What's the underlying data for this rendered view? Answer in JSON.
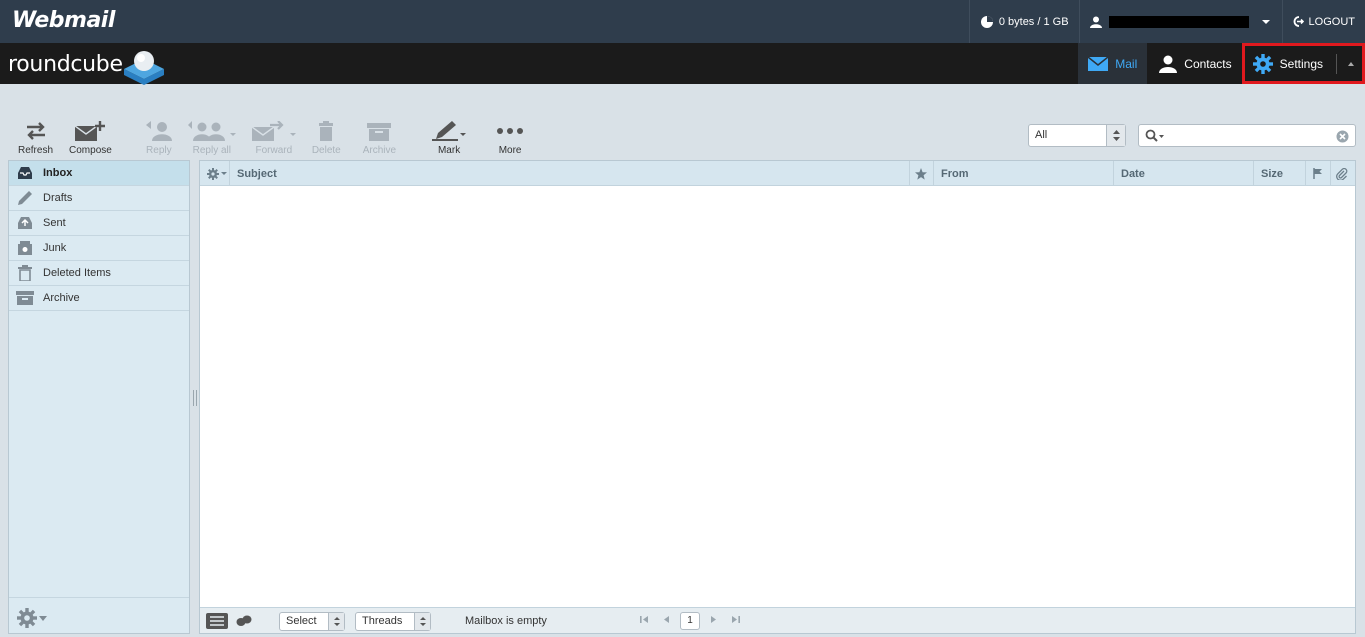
{
  "topbar": {
    "brand": "Webmail",
    "quota": "0 bytes / 1 GB",
    "logout": "LOGOUT"
  },
  "header": {
    "logo": "roundcube",
    "tasks": {
      "mail": "Mail",
      "contacts": "Contacts",
      "settings": "Settings"
    }
  },
  "toolbar": {
    "refresh": "Refresh",
    "compose": "Compose",
    "reply": "Reply",
    "reply_all": "Reply all",
    "forward": "Forward",
    "delete": "Delete",
    "archive": "Archive",
    "mark": "Mark",
    "more": "More"
  },
  "filter": {
    "value": "All"
  },
  "search": {
    "value": ""
  },
  "folders": [
    "Inbox",
    "Drafts",
    "Sent",
    "Junk",
    "Deleted Items",
    "Archive"
  ],
  "columns": {
    "subject": "Subject",
    "from": "From",
    "date": "Date",
    "size": "Size"
  },
  "footer": {
    "select": "Select",
    "threads": "Threads",
    "status": "Mailbox is empty",
    "page": "1"
  },
  "colors": {
    "topbar": "#2f3d4c",
    "header": "#1b1b1b",
    "accent": "#3fa9f5",
    "highlight": "#e0191e"
  }
}
